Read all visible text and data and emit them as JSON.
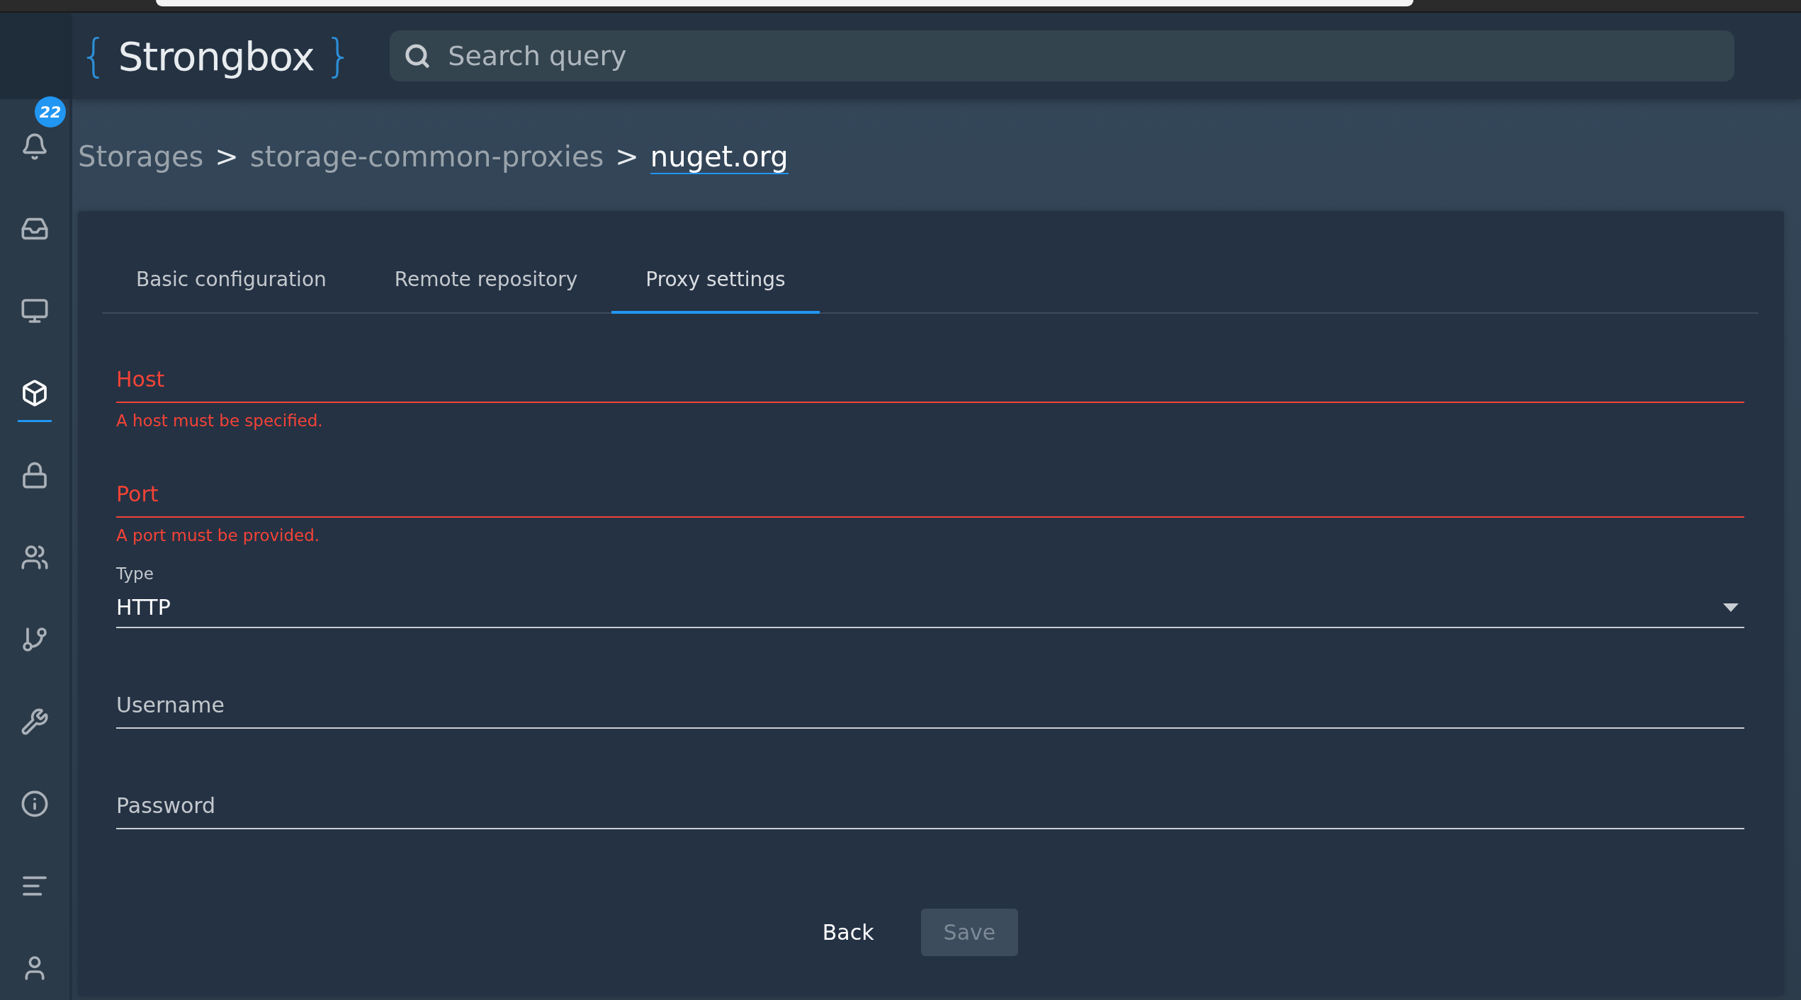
{
  "logo": {
    "open": "{",
    "name": "Strongbox",
    "close": "}"
  },
  "search": {
    "placeholder": "Search query"
  },
  "sidebar": {
    "items": [
      {
        "badge": "22",
        "selected": false
      },
      {
        "selected": false
      },
      {
        "selected": false
      },
      {
        "selected": true
      },
      {
        "selected": false
      },
      {
        "selected": false
      },
      {
        "selected": false
      },
      {
        "selected": false
      },
      {
        "selected": false
      },
      {
        "selected": false
      },
      {
        "selected": false
      }
    ]
  },
  "breadcrumb": [
    {
      "label": "Storages",
      "current": false
    },
    {
      "label": "storage-common-proxies",
      "current": false
    },
    {
      "label": "nuget.org",
      "current": true
    }
  ],
  "breadcrumb_separator": ">",
  "tabs": [
    {
      "label": "Basic configuration",
      "selected": false
    },
    {
      "label": "Remote repository",
      "selected": false
    },
    {
      "label": "Proxy settings",
      "selected": true
    }
  ],
  "fields": [
    {
      "kind": "text",
      "placeholder": "Host",
      "invalid": true,
      "error": "A host must be specified."
    },
    {
      "kind": "text",
      "placeholder": "Port",
      "invalid": true,
      "error": "A port must be provided."
    },
    {
      "kind": "select",
      "label": "Type",
      "value": "HTTP",
      "invalid": false
    },
    {
      "kind": "text",
      "placeholder": "Username",
      "invalid": false
    },
    {
      "kind": "text",
      "placeholder": "Password",
      "invalid": false
    }
  ],
  "buttons": [
    {
      "label": "Back",
      "disabled": false
    },
    {
      "label": "Save",
      "disabled": true
    }
  ]
}
